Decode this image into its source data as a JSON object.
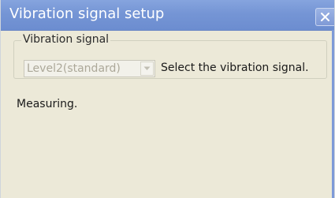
{
  "window": {
    "title": "Vibration signal setup"
  },
  "groupbox": {
    "legend": "Vibration signal"
  },
  "combo": {
    "value": "Level2(standard)",
    "disabled": true
  },
  "hint": "Select the vibration signal.",
  "status": "Measuring.",
  "colors": {
    "titlebar": "#7595d5",
    "dialog_bg": "#ece9d8",
    "disabled_text": "#aca899"
  },
  "icons": {
    "close": "close-icon",
    "dropdown": "chevron-down-icon"
  }
}
